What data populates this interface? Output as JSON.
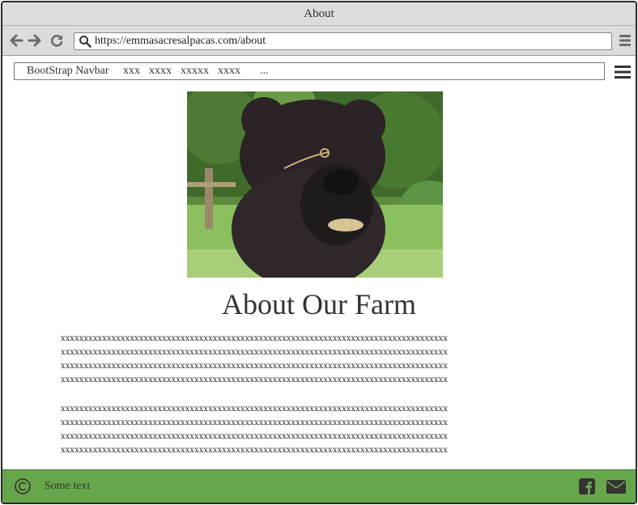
{
  "window": {
    "title": "About"
  },
  "browser": {
    "url": "https://emmasacresalpacas.com/about",
    "icons": [
      "back-arrow-icon",
      "forward-arrow-icon",
      "refresh-icon",
      "search-icon",
      "menu-icon"
    ]
  },
  "navbar": {
    "brand": "BootStrap Navbar",
    "links": [
      "xxx",
      "xxxx",
      "xxxxx",
      "xxxx",
      "..."
    ]
  },
  "hero": {
    "alt": "Alpaca photo"
  },
  "page": {
    "heading": "About Our Farm",
    "paragraph1": [
      "xxxxxxxxxxxxxxxxxxxxxxxxxxxxxxxxxxxxxxxxxxxxxxxxxxxxxxxxxxxxxxxxxxxxxxxxxxxxxxxxxxxx",
      "xxxxxxxxxxxxxxxxxxxxxxxxxxxxxxxxxxxxxxxxxxxxxxxxxxxxxxxxxxxxxxxxxxxxxxxxxxxxxxxxxxxx",
      "xxxxxxxxxxxxxxxxxxxxxxxxxxxxxxxxxxxxxxxxxxxxxxxxxxxxxxxxxxxxxxxxxxxxxxxxxxxxxxxxxxxx",
      "xxxxxxxxxxxxxxxxxxxxxxxxxxxxxxxxxxxxxxxxxxxxxxxxxxxxxxxxxxxxxxxxxxxxxxxxxxxxxxxxxxxx"
    ],
    "paragraph2": [
      "xxxxxxxxxxxxxxxxxxxxxxxxxxxxxxxxxxxxxxxxxxxxxxxxxxxxxxxxxxxxxxxxxxxxxxxxxxxxxxxxxxxx",
      "xxxxxxxxxxxxxxxxxxxxxxxxxxxxxxxxxxxxxxxxxxxxxxxxxxxxxxxxxxxxxxxxxxxxxxxxxxxxxxxxxxxx",
      "xxxxxxxxxxxxxxxxxxxxxxxxxxxxxxxxxxxxxxxxxxxxxxxxxxxxxxxxxxxxxxxxxxxxxxxxxxxxxxxxxxxx",
      "xxxxxxxxxxxxxxxxxxxxxxxxxxxxxxxxxxxxxxxxxxxxxxxxxxxxxxxxxxxxxxxxxxxxxxxxxxxxxxxxxxxx"
    ]
  },
  "footer": {
    "text": "Some text",
    "icons": [
      "copyright-icon",
      "facebook-icon",
      "mail-icon"
    ]
  },
  "colors": {
    "footer_bg": "#67a74c",
    "chrome_bg": "#dcdcdc"
  }
}
